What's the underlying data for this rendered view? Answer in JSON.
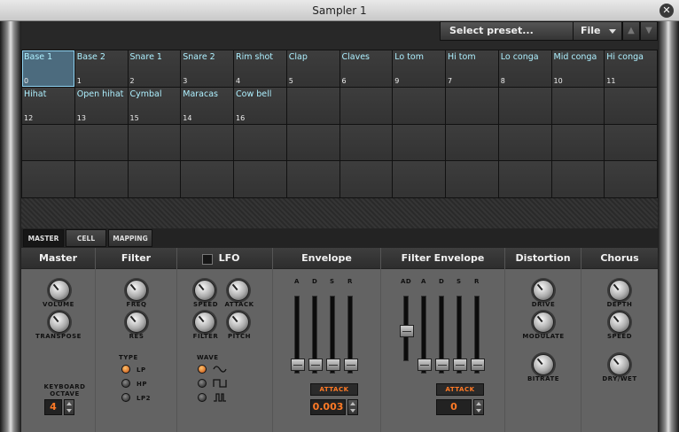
{
  "window": {
    "title": "Sampler 1"
  },
  "toolbar": {
    "preset_label": "Select preset...",
    "file_label": "File"
  },
  "cells": [
    {
      "name": "Base 1",
      "number": "0"
    },
    {
      "name": "Base 2",
      "number": "1"
    },
    {
      "name": "Snare 1",
      "number": "2"
    },
    {
      "name": "Snare 2",
      "number": "3"
    },
    {
      "name": "Rim shot",
      "number": "4"
    },
    {
      "name": "Clap",
      "number": "5"
    },
    {
      "name": "Claves",
      "number": "6"
    },
    {
      "name": "Lo tom",
      "number": "9"
    },
    {
      "name": "Hi tom",
      "number": "7"
    },
    {
      "name": "Lo conga",
      "number": "8"
    },
    {
      "name": "Mid conga",
      "number": "10"
    },
    {
      "name": "Hi conga",
      "number": "11"
    },
    {
      "name": "Hihat",
      "number": "12"
    },
    {
      "name": "Open hihat",
      "number": "13"
    },
    {
      "name": "Cymbal",
      "number": "15"
    },
    {
      "name": "Maracas",
      "number": "14"
    },
    {
      "name": "Cow bell",
      "number": "16"
    }
  ],
  "tabs": [
    "MASTER",
    "CELL",
    "MAPPING"
  ],
  "master": {
    "title": "Master",
    "volume": "VOLUME",
    "transpose": "TRANSPOSE",
    "keyboard_line1": "KEYBOARD",
    "keyboard_line2": "OCTAVE",
    "octave_value": "4"
  },
  "filter": {
    "title": "Filter",
    "freq": "FREQ",
    "res": "RES",
    "type_label": "TYPE",
    "types": [
      "LP",
      "HP",
      "LP2"
    ]
  },
  "lfo": {
    "title": "LFO",
    "speed": "SPEED",
    "attack": "ATTACK",
    "filter": "FILTER",
    "pitch": "PITCH",
    "wave_label": "WAVE"
  },
  "envelope": {
    "title": "Envelope",
    "sliders": [
      "A",
      "D",
      "S",
      "R"
    ],
    "mode": "ATTACK",
    "value": "0.003"
  },
  "filter_envelope": {
    "title": "Filter Envelope",
    "sliders": [
      "AD",
      "A",
      "D",
      "S",
      "R"
    ],
    "mode": "ATTACK",
    "value": "0"
  },
  "distortion": {
    "title": "Distortion",
    "drive": "DRIVE",
    "modulate": "MODULATE",
    "bitrate": "BITRATE"
  },
  "chorus": {
    "title": "Chorus",
    "depth": "DEPTH",
    "speed": "SPEED",
    "drywet": "DRY/WET"
  },
  "colors": {
    "accent": "#ff7a26",
    "cell_text": "#aef0ff",
    "selection": "#8fd3f2"
  }
}
